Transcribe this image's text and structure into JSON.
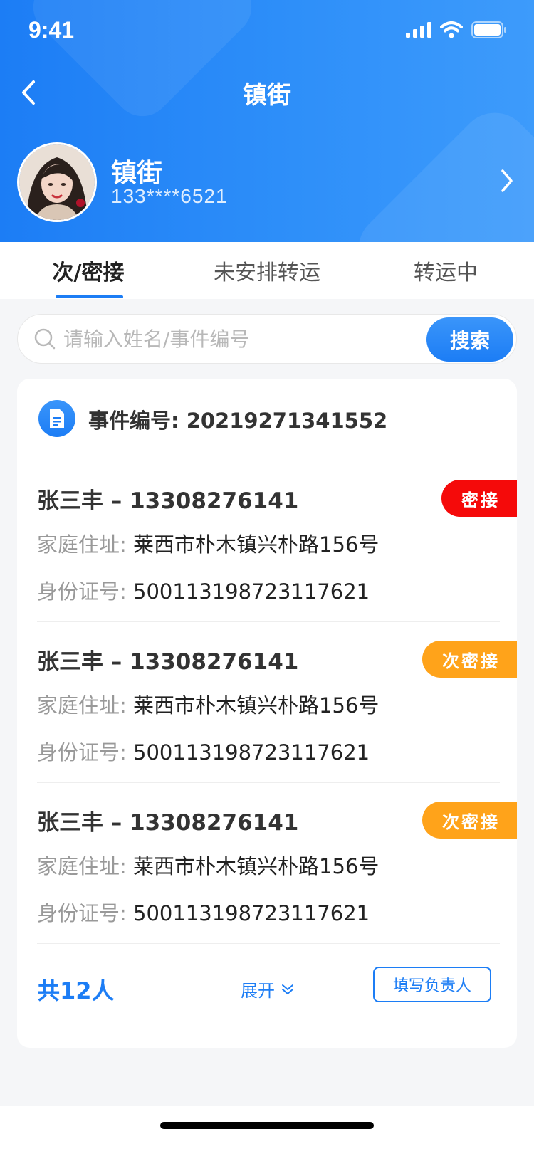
{
  "status_bar": {
    "time": "9:41"
  },
  "nav": {
    "title": "镇街"
  },
  "profile": {
    "name": "镇街",
    "phone": "133****6521"
  },
  "tabs": [
    {
      "label": "次/密接",
      "active": true
    },
    {
      "label": "未安排转运",
      "active": false
    },
    {
      "label": "转运中",
      "active": false
    }
  ],
  "search": {
    "placeholder": "请输入姓名/事件编号",
    "value": "",
    "button_label": "搜索"
  },
  "event": {
    "label": "事件编号: 20219271341552"
  },
  "people": [
    {
      "name_phone": "张三丰 – 13308276141",
      "badge": "密接",
      "badge_color": "#f50a0a",
      "address_label": "家庭住址:",
      "address": "莱西市朴木镇兴朴路156号",
      "id_label": "身份证号:",
      "id_number": "500113198723117621"
    },
    {
      "name_phone": "张三丰 – 13308276141",
      "badge": "次密接",
      "badge_color": "#ffa31a",
      "address_label": "家庭住址:",
      "address": "莱西市朴木镇兴朴路156号",
      "id_label": "身份证号:",
      "id_number": "500113198723117621"
    },
    {
      "name_phone": "张三丰 – 13308276141",
      "badge": "次密接",
      "badge_color": "#ffa31a",
      "address_label": "家庭住址:",
      "address": "莱西市朴木镇兴朴路156号",
      "id_label": "身份证号:",
      "id_number": "500113198723117621"
    }
  ],
  "footer": {
    "total": "共12人",
    "expand_label": "展开",
    "fill_button": "填写负责人"
  },
  "colors": {
    "primary": "#1c7df5",
    "red_badge": "#f50a0a",
    "orange_badge": "#ffa31a"
  }
}
